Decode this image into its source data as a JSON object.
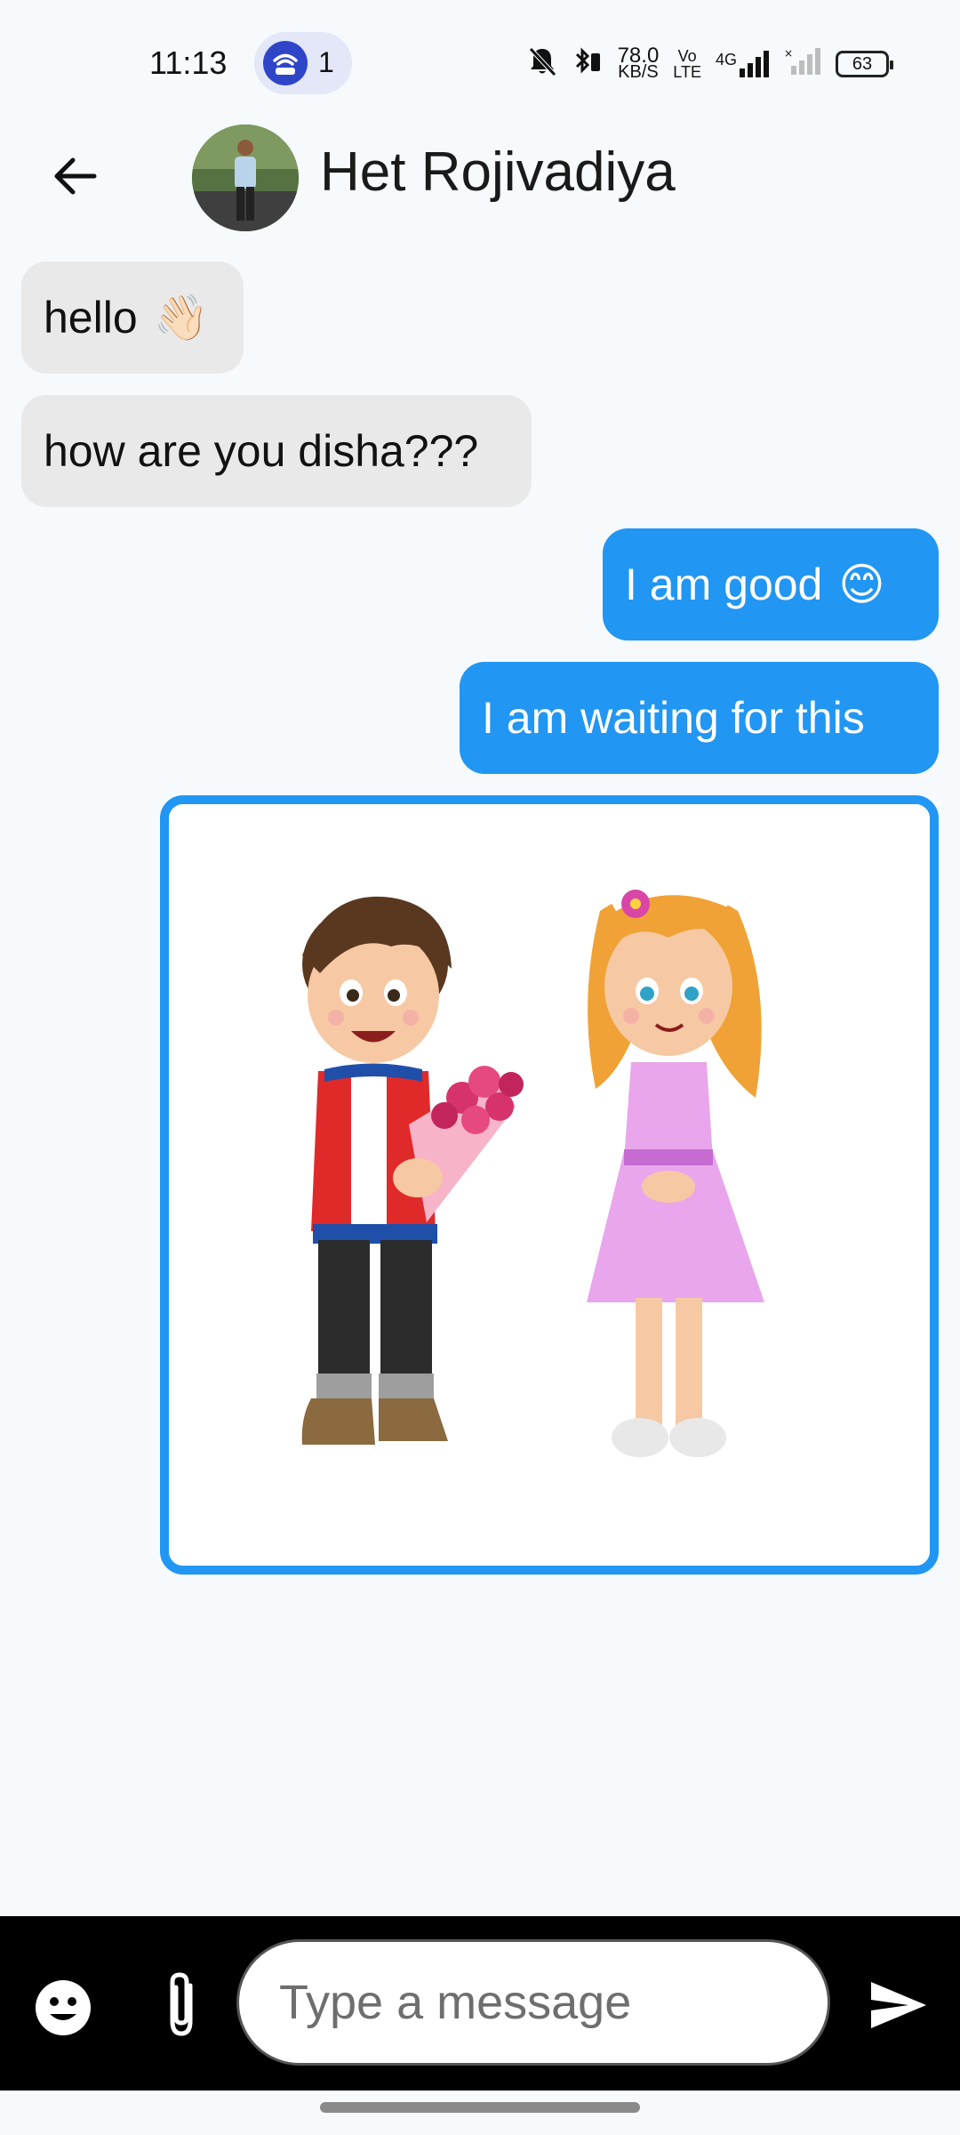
{
  "status_bar": {
    "time": "11:13",
    "hotspot_count": "1",
    "net_speed_value": "78.0",
    "net_speed_unit": "KB/S",
    "volte_top": "Vo",
    "volte_bottom": "LTE",
    "network_type": "4G",
    "battery_level": "63"
  },
  "header": {
    "contact_name": "Het Rojivadiya"
  },
  "messages": [
    {
      "direction": "incoming",
      "text": "hello",
      "emoji": "👋🏻"
    },
    {
      "direction": "incoming",
      "text": "how are you disha???"
    },
    {
      "direction": "outgoing",
      "text": "I am good",
      "emoji": "😊"
    },
    {
      "direction": "outgoing",
      "text": "I am waiting for this"
    },
    {
      "direction": "outgoing",
      "type": "image",
      "image": "cartoon-boy-girl-flowers"
    }
  ],
  "composer": {
    "placeholder": "Type a message"
  },
  "colors": {
    "outgoing_bubble": "#2196f3",
    "incoming_bubble": "#e9e9e9",
    "background": "#f6fafd",
    "composer_bar": "#000000"
  }
}
